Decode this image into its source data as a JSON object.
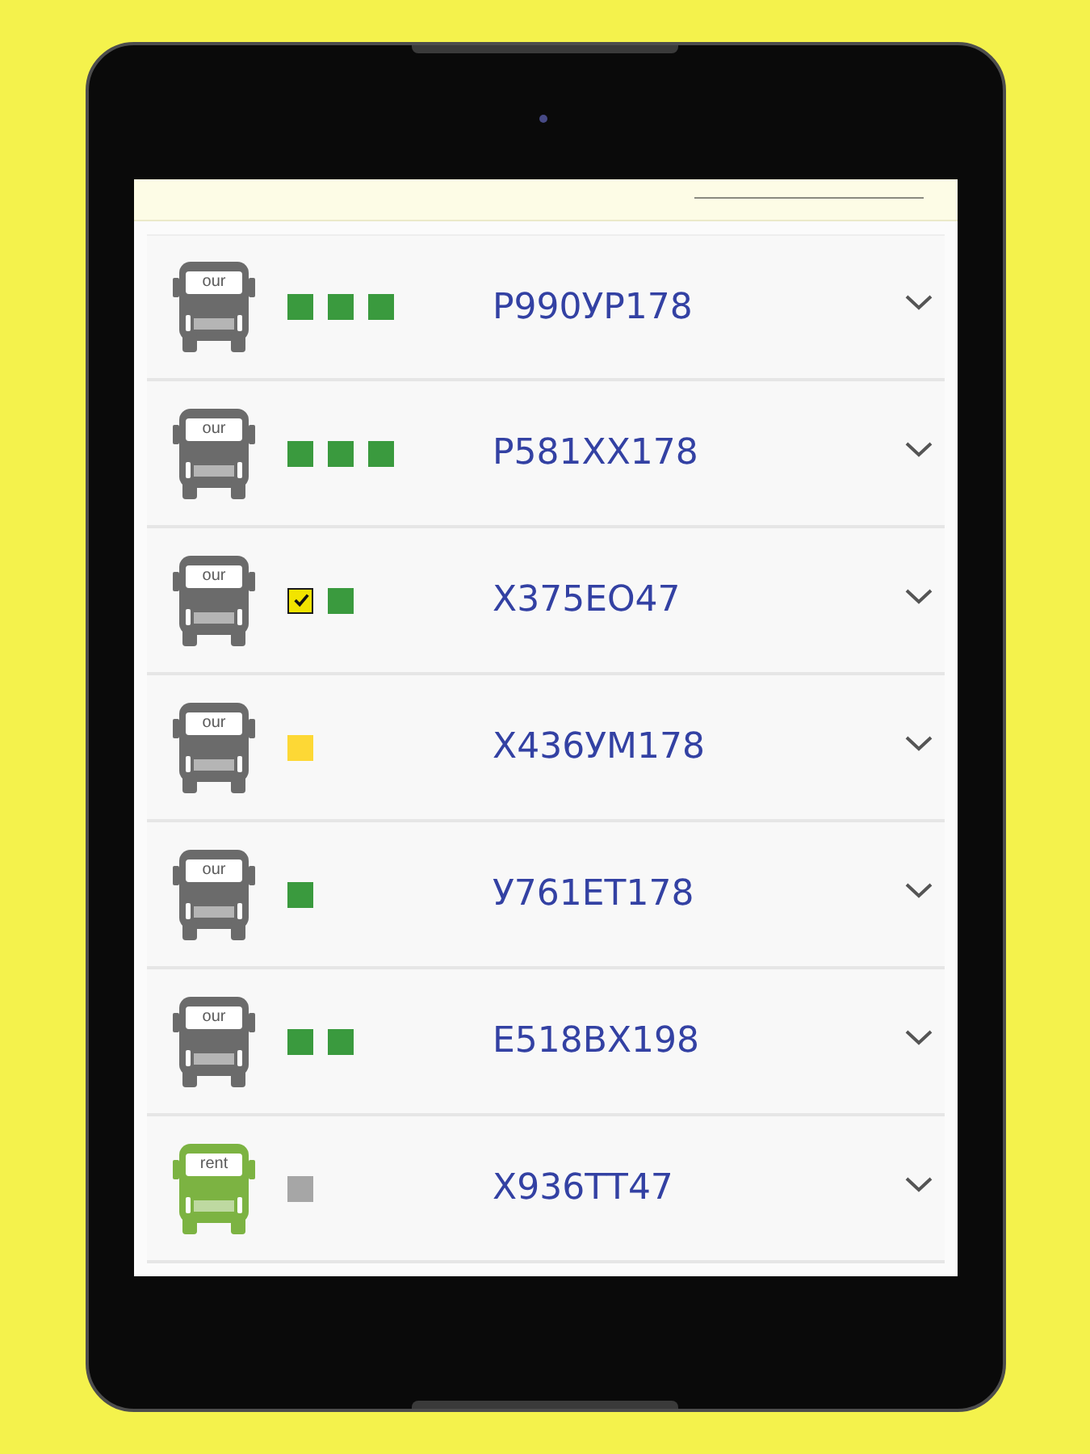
{
  "vehicles": [
    {
      "truck": {
        "kind": "own",
        "label": "our"
      },
      "marks": [
        {
          "kind": "square",
          "color": "#3a9a3e"
        },
        {
          "kind": "square",
          "color": "#3a9a3e"
        },
        {
          "kind": "square",
          "color": "#3a9a3e"
        }
      ],
      "plate": "Р990УР178"
    },
    {
      "truck": {
        "kind": "own",
        "label": "our"
      },
      "marks": [
        {
          "kind": "square",
          "color": "#3a9a3e"
        },
        {
          "kind": "square",
          "color": "#3a9a3e"
        },
        {
          "kind": "square",
          "color": "#3a9a3e"
        }
      ],
      "plate": "Р581ХХ178"
    },
    {
      "truck": {
        "kind": "own",
        "label": "our"
      },
      "marks": [
        {
          "kind": "check",
          "color": "#f2e400"
        },
        {
          "kind": "square",
          "color": "#3a9a3e"
        }
      ],
      "plate": "Х375ЕО47"
    },
    {
      "truck": {
        "kind": "own",
        "label": "our"
      },
      "marks": [
        {
          "kind": "square",
          "color": "#fdd835"
        }
      ],
      "plate": "Х436УМ178"
    },
    {
      "truck": {
        "kind": "own",
        "label": "our"
      },
      "marks": [
        {
          "kind": "square",
          "color": "#3a9a3e"
        }
      ],
      "plate": "У761ЕТ178"
    },
    {
      "truck": {
        "kind": "own",
        "label": "our"
      },
      "marks": [
        {
          "kind": "square",
          "color": "#3a9a3e"
        },
        {
          "kind": "square",
          "color": "#3a9a3e"
        }
      ],
      "plate": "Е518ВХ198"
    },
    {
      "truck": {
        "kind": "rent",
        "label": "rent"
      },
      "marks": [
        {
          "kind": "square",
          "color": "#a6a6a6"
        }
      ],
      "plate": "Х936ТТ47"
    }
  ]
}
